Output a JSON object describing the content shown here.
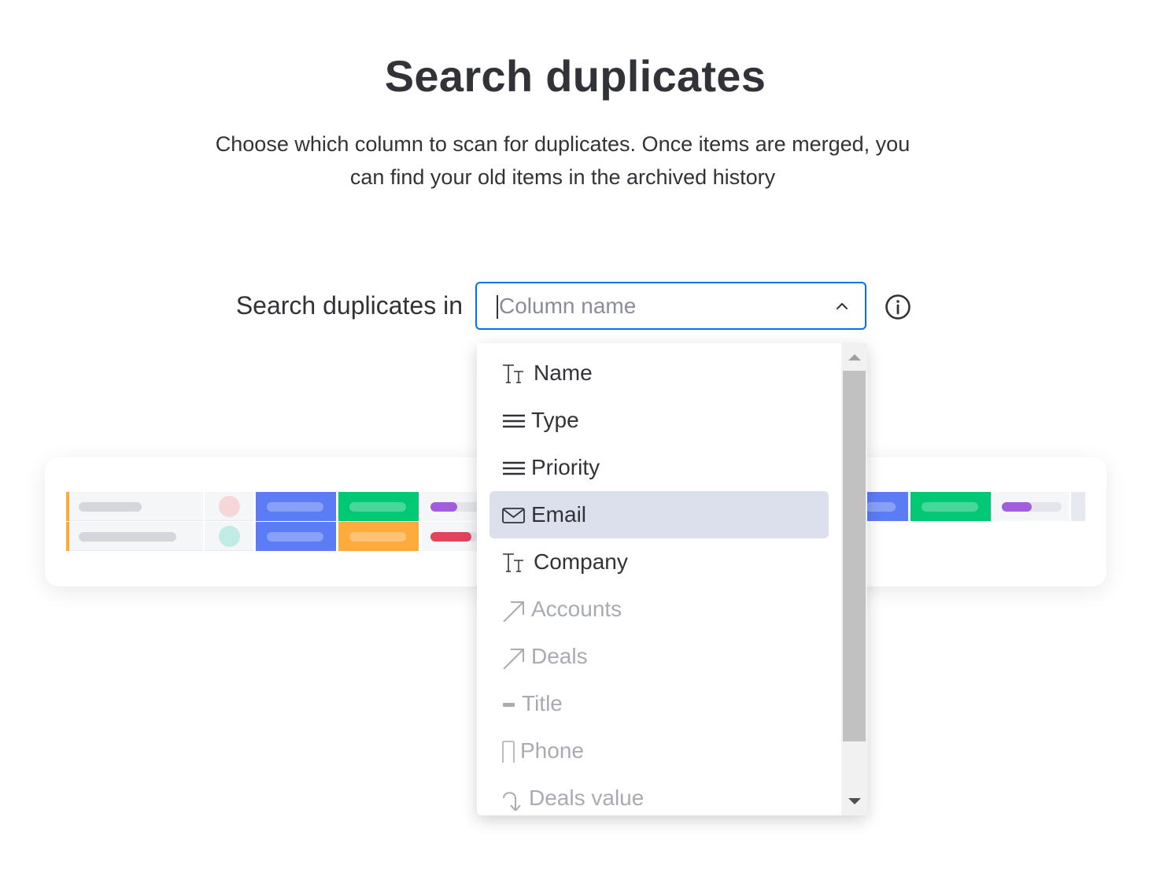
{
  "header": {
    "title": "Search duplicates",
    "subtitle_line1": "Choose which column to scan for duplicates. Once items are merged, you",
    "subtitle_line2": "can find your old items in the archived history"
  },
  "search": {
    "label": "Search duplicates in",
    "placeholder": "Column name",
    "value": "",
    "expanded": true
  },
  "dropdown": {
    "options": [
      {
        "label": "Name",
        "icon": "text-type-icon",
        "enabled": true,
        "selected": false
      },
      {
        "label": "Type",
        "icon": "status-lines-icon",
        "enabled": true,
        "selected": false
      },
      {
        "label": "Priority",
        "icon": "status-lines-icon",
        "enabled": true,
        "selected": false
      },
      {
        "label": "Email",
        "icon": "email-icon",
        "enabled": true,
        "selected": true
      },
      {
        "label": "Company",
        "icon": "text-type-icon",
        "enabled": true,
        "selected": false
      },
      {
        "label": "Accounts",
        "icon": "connect-arrow-icon",
        "enabled": false,
        "selected": false
      },
      {
        "label": "Deals",
        "icon": "connect-arrow-icon",
        "enabled": false,
        "selected": false
      },
      {
        "label": "Title",
        "icon": "dropdown-dash-icon",
        "enabled": false,
        "selected": false
      },
      {
        "label": "Phone",
        "icon": "phone-icon",
        "enabled": false,
        "selected": false
      },
      {
        "label": "Deals value",
        "icon": "mirror-icon",
        "enabled": false,
        "selected": false
      }
    ]
  },
  "colors": {
    "accent": "#0073ea",
    "selected_bg": "#dcdfec",
    "status_blue": "#5b7cf5",
    "status_green": "#00c875",
    "status_orange": "#fdab3d",
    "status_purple": "#a25ddc",
    "status_red": "#e2445c"
  }
}
